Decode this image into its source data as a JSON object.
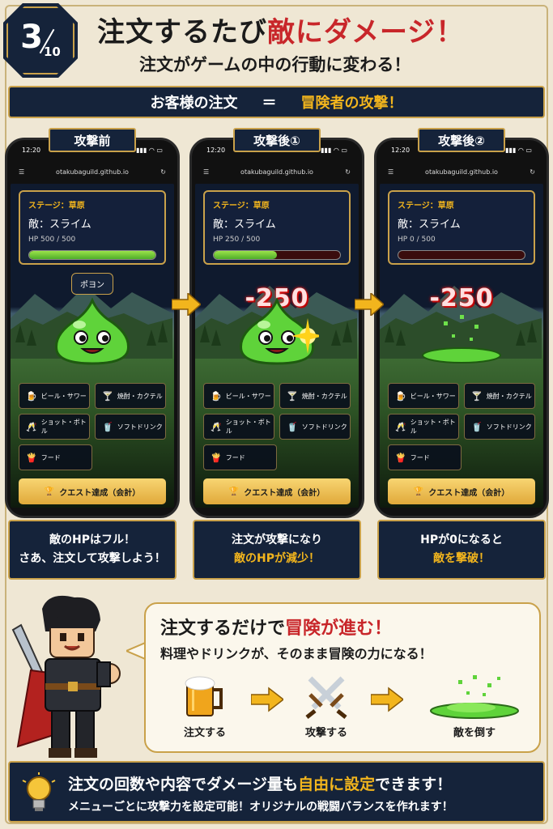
{
  "badge": {
    "current": "3",
    "total": "10"
  },
  "header": {
    "title_a": "注文するたび",
    "title_b": "敵にダメージ！",
    "subtitle": "注文がゲームの中の行動に変わる！"
  },
  "banner": {
    "left": "お客様の注文",
    "eq": "＝",
    "right": "冒険者の攻撃！"
  },
  "phones": [
    {
      "tag": "攻撃前",
      "time": "12:20",
      "url": "otakubaguild.github.io",
      "stage": "ステージ：草原",
      "enemy": "敵：スライム",
      "hp_text": "HP 500 / 500",
      "hp_fraction": 1.0,
      "monster_label": "ポヨン",
      "damage": "",
      "caption_1": "敵のHPはフル！",
      "caption_2": "さあ、注文して攻撃しよう！"
    },
    {
      "tag": "攻撃後①",
      "time": "12:20",
      "url": "otakubaguild.github.io",
      "stage": "ステージ：草原",
      "enemy": "敵：スライム",
      "hp_text": "HP 250 / 500",
      "hp_fraction": 0.5,
      "monster_label": "",
      "damage": "-250",
      "caption_1": "注文が攻撃になり",
      "caption_2": "敵のHPが減少！"
    },
    {
      "tag": "攻撃後②",
      "time": "12:20",
      "url": "otakubaguild.github.io",
      "stage": "ステージ：草原",
      "enemy": "敵：スライム",
      "hp_text": "HP 0 / 500",
      "hp_fraction": 0.0,
      "monster_label": "",
      "damage": "-250",
      "caption_1": "HPが0になると",
      "caption_2": "敵を撃破！"
    }
  ],
  "menu": {
    "beer": "ビール・サワー",
    "shochu": "焼酎・カクテル",
    "shot": "ショット・ボトル",
    "soft": "ソフトドリンク",
    "food": "フード",
    "quest": "クエスト達成（会計）"
  },
  "bubble": {
    "title_a": "注文するだけで",
    "title_b": "冒険が進む！",
    "subtitle": "料理やドリンクが、そのまま冒険の力になる！",
    "step1": "注文する",
    "step2": "攻撃する",
    "step3": "敵を倒す"
  },
  "footer": {
    "title_a": "注文の回数や内容でダメージ量も",
    "title_b": "自由に設定",
    "title_c": "できます！",
    "subtitle": "メニューごとに攻撃力を設定可能！オリジナルの戦闘バランスを作れます！"
  },
  "colors": {
    "accent_red": "#c8262a",
    "gold": "#f2b51d",
    "navy": "#15233a",
    "slime": "#5fd33a"
  }
}
